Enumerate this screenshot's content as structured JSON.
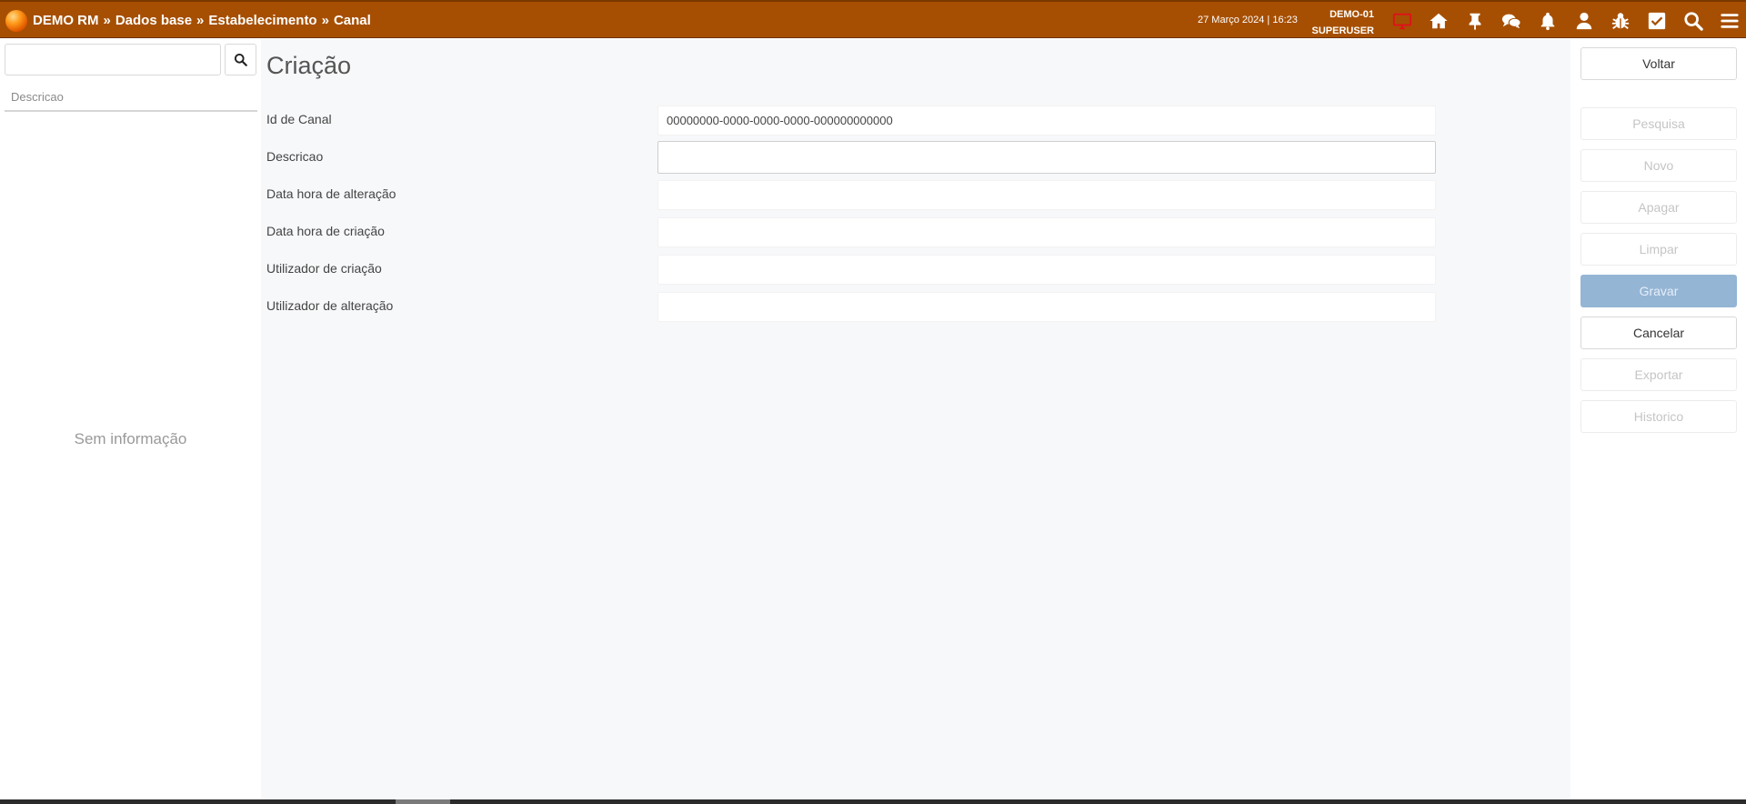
{
  "header": {
    "breadcrumb": [
      "DEMO RM",
      "Dados base",
      "Estabelecimento",
      "Canal"
    ],
    "separator": "»",
    "datetime": "27 Março 2024 | 16:23",
    "company": "DEMO-01",
    "user": "SUPERUSER",
    "bar_color": "#a64f02",
    "icons": [
      "monitor-icon",
      "home-icon",
      "pin-icon",
      "chat-icon",
      "bell-icon",
      "user-icon",
      "bug-icon",
      "checkbox-icon",
      "search-icon",
      "menu-icon"
    ]
  },
  "sidebar": {
    "search_value": "",
    "column_header": "Descricao",
    "empty_text": "Sem informação"
  },
  "form": {
    "title": "Criação",
    "fields": [
      {
        "label": "Id de Canal",
        "value": "00000000-0000-0000-0000-000000000000"
      },
      {
        "label": "Descricao",
        "value": ""
      },
      {
        "label": "Data hora de alteração",
        "value": ""
      },
      {
        "label": "Data hora de criação",
        "value": ""
      },
      {
        "label": "Utilizador de criação",
        "value": ""
      },
      {
        "label": "Utilizador de alteração",
        "value": ""
      }
    ]
  },
  "actions": {
    "voltar": "Voltar",
    "pesquisa": "Pesquisa",
    "novo": "Novo",
    "apagar": "Apagar",
    "limpar": "Limpar",
    "gravar": "Gravar",
    "cancelar": "Cancelar",
    "exportar": "Exportar",
    "historico": "Historico"
  }
}
